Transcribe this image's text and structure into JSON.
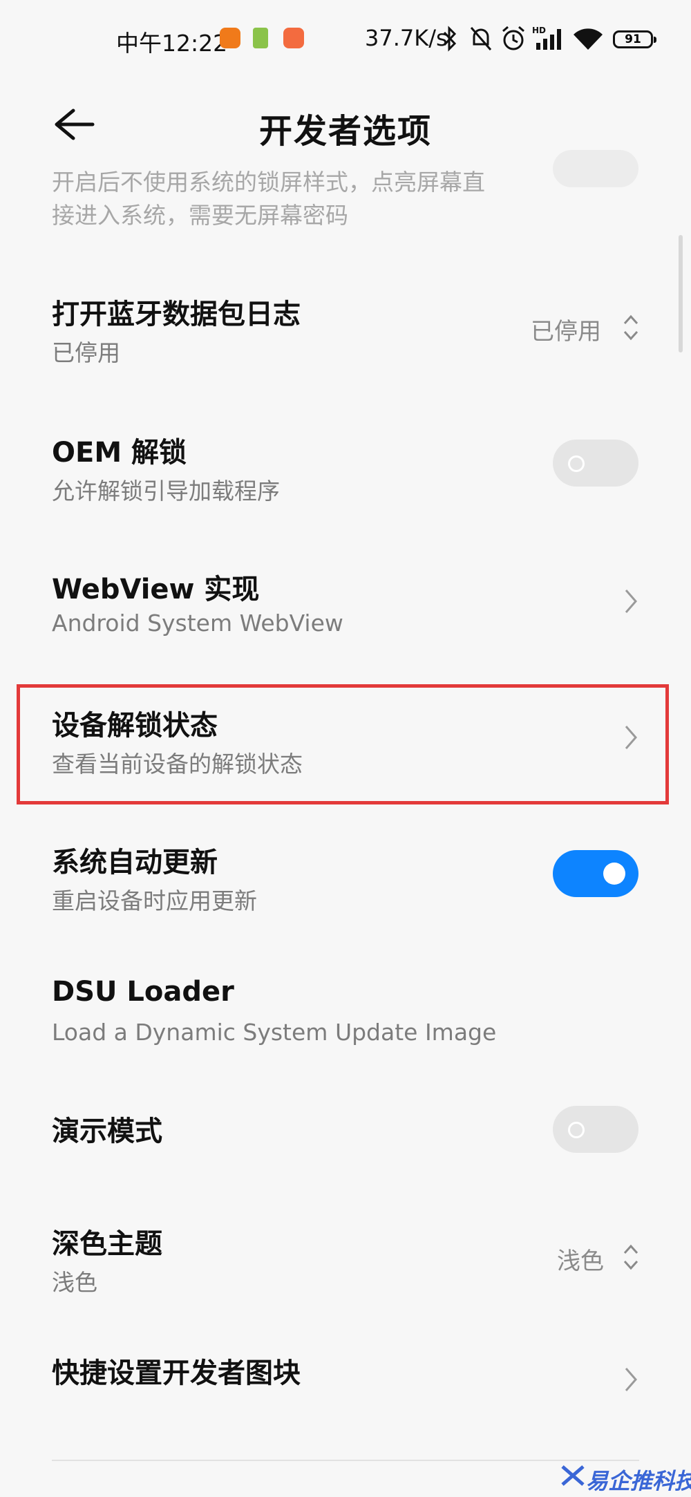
{
  "status_bar": {
    "time": "中午12:22",
    "net_speed": "37.7K/s",
    "battery": "91",
    "icons": [
      "mi-app-icon",
      "green-app-icon",
      "orange-app-icon",
      "bluetooth-icon",
      "mute-icon",
      "alarm-icon",
      "signal-icon",
      "wifi-icon",
      "battery-icon"
    ]
  },
  "header": {
    "title": "开发者选项",
    "back_icon": "back-arrow-icon"
  },
  "items": [
    {
      "sub": "开启后不使用系统的锁屏样式，点亮屏幕直",
      "sub2": "接进入系统，需要无屏幕密码",
      "control": "toggle",
      "on": false
    },
    {
      "title": "打开蓝牙数据包日志",
      "sub": "已停用",
      "value": "已停用",
      "control": "select"
    },
    {
      "title": "OEM 解锁",
      "sub": "允许解锁引导加载程序",
      "control": "toggle",
      "on": false
    },
    {
      "title": "WebView 实现",
      "sub": "Android System WebView",
      "control": "chevron"
    },
    {
      "title": "设备解锁状态",
      "sub": "查看当前设备的解锁状态",
      "control": "chevron",
      "highlighted": true
    },
    {
      "title": "系统自动更新",
      "sub": "重启设备时应用更新",
      "control": "toggle",
      "on": true
    },
    {
      "title": "DSU Loader",
      "sub": "Load a Dynamic System Update Image",
      "control": "none"
    },
    {
      "title": "演示模式",
      "control": "toggle",
      "on": false
    },
    {
      "title": "深色主题",
      "sub": "浅色",
      "value": "浅色",
      "control": "select"
    },
    {
      "title": "快捷设置开发者图块",
      "control": "chevron"
    }
  ],
  "watermark": "易企推科技",
  "colors": {
    "accent": "#0d84ff",
    "highlight": "#e33a3a",
    "background": "#f7f7f7"
  }
}
